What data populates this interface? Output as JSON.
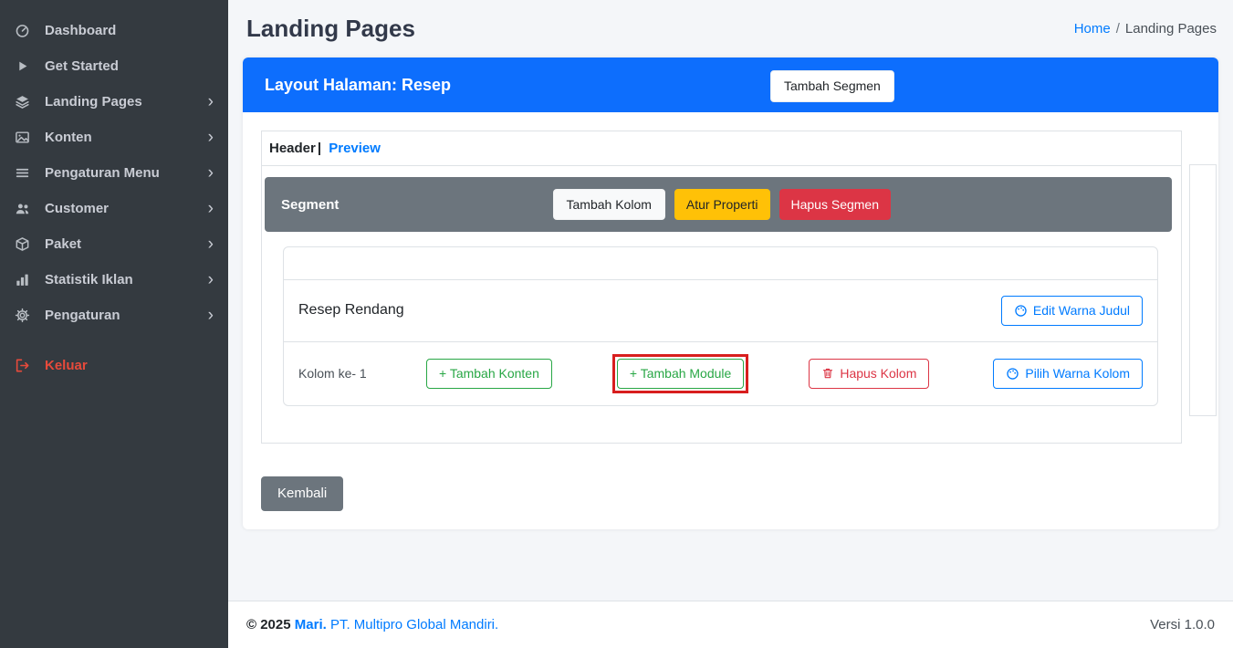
{
  "colors": {
    "sidebar_bg": "#343a40",
    "primary_header": "#0d6efd",
    "link_blue": "#007bff",
    "warning_yellow": "#ffc107",
    "danger_red": "#dc3545",
    "success_green": "#28a745",
    "secondary_gray": "#6c757d",
    "logout_red": "#e74a3b",
    "annotation_red": "#d81e1e"
  },
  "sidebar": {
    "items": [
      {
        "label": "Dashboard"
      },
      {
        "label": "Get Started"
      },
      {
        "label": "Landing Pages"
      },
      {
        "label": "Konten"
      },
      {
        "label": "Pengaturan Menu"
      },
      {
        "label": "Customer"
      },
      {
        "label": "Paket"
      },
      {
        "label": "Statistik Iklan"
      },
      {
        "label": "Pengaturan"
      }
    ],
    "chevron": "›",
    "logout_label": "Keluar"
  },
  "header": {
    "title": "Landing Pages",
    "breadcrumb_home": "Home",
    "breadcrumb_separator": "/",
    "breadcrumb_current": "Landing Pages"
  },
  "layout_card": {
    "title": "Layout Halaman: Resep",
    "add_segment_button": "Tambah Segmen",
    "tab_active": "Header",
    "tab_separator": "|",
    "tab_preview": "Preview",
    "segment": {
      "title": "Segment",
      "add_column_button": "Tambah Kolom",
      "properties_button": "Atur Properti",
      "delete_segment_button": "Hapus Segmen"
    },
    "panel": {
      "title": "Resep Rendang",
      "edit_title_color_button": "Edit Warna Judul",
      "column_label": "Kolom ke- 1",
      "add_content_button": "+ Tambah Konten",
      "add_module_button": "+ Tambah Module",
      "delete_column_button": "Hapus Kolom",
      "pick_column_color_button": "Pilih Warna Kolom"
    },
    "back_button": "Kembali"
  },
  "footer": {
    "copyright": "© 2025",
    "brand": "Mari.",
    "company": "PT. Multipro Global Mandiri.",
    "version": "Versi 1.0.0"
  }
}
